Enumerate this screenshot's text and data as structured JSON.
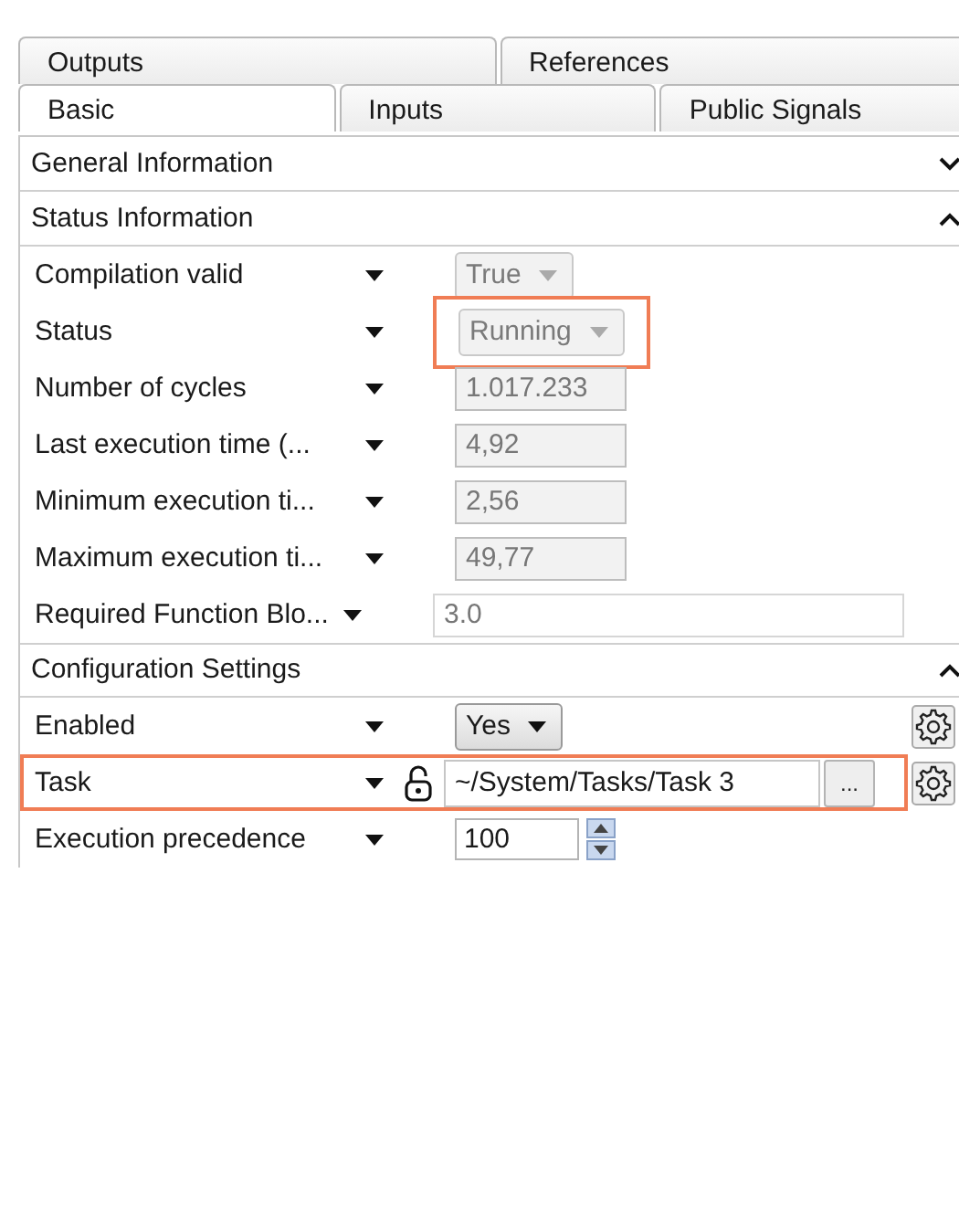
{
  "tab_rows": [
    [
      {
        "label": "Outputs",
        "selected": false
      },
      {
        "label": "References",
        "selected": false
      }
    ],
    [
      {
        "label": "Basic",
        "selected": true
      },
      {
        "label": "Inputs",
        "selected": false
      },
      {
        "label": "Public Signals",
        "selected": false
      }
    ]
  ],
  "sections": [
    {
      "title": "General Information",
      "expanded": false
    },
    {
      "title": "Status Information",
      "expanded": true,
      "properties": [
        {
          "label": "Compilation valid",
          "kind": "dropdown",
          "value": "True",
          "disabled": true
        },
        {
          "label": "Status",
          "kind": "dropdown",
          "value": "Running",
          "disabled": true,
          "highlighted": true
        },
        {
          "label": "Number of cycles",
          "kind": "readonly",
          "value": "1.017.233"
        },
        {
          "label": "Last execution time (...",
          "kind": "readonly",
          "value": "4,92"
        },
        {
          "label": "Minimum execution ti...",
          "kind": "readonly",
          "value": "2,56"
        },
        {
          "label": "Maximum execution ti...",
          "kind": "readonly",
          "value": "49,77"
        },
        {
          "label": "Required Function Blo...",
          "kind": "text",
          "value": "3.0"
        }
      ]
    },
    {
      "title": "Configuration Settings",
      "expanded": true,
      "properties": [
        {
          "label": "Enabled",
          "kind": "dropdown",
          "value": "Yes",
          "disabled": false,
          "gear": true
        },
        {
          "label": "Task",
          "kind": "path",
          "value": "~/System/Tasks/Task 3",
          "browse": "...",
          "highlighted": true,
          "gear": true
        },
        {
          "label": "Execution precedence",
          "kind": "spinner",
          "value": "100"
        }
      ]
    }
  ]
}
